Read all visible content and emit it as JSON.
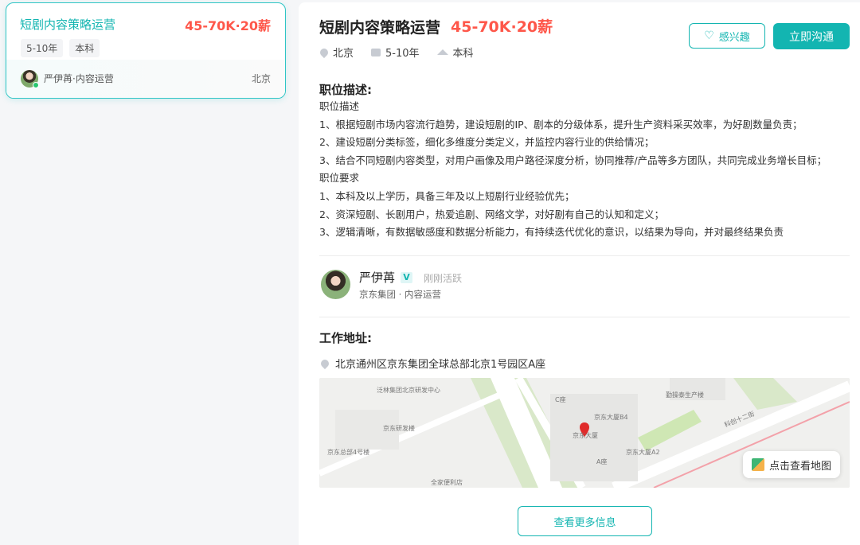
{
  "card": {
    "title": "短剧内容策略运营",
    "salary": "45-70K·20薪",
    "tags": [
      "5-10年",
      "本科"
    ],
    "recruiter": "严伊苒·内容运营",
    "city": "北京"
  },
  "job": {
    "title": "短剧内容策略运营",
    "salary": "45-70K·20薪",
    "city": "北京",
    "experience": "5-10年",
    "education": "本科",
    "interest_label": "感兴趣",
    "chat_label": "立即沟通"
  },
  "description": {
    "heading": "职位描述:",
    "lines": [
      "职位描述",
      "1、根据短剧市场内容流行趋势，建设短剧的IP、剧本的分级体系，提升生产资料采买效率，为好剧数量负责；",
      "2、建设短剧分类标签，细化多维度分类定义，并监控内容行业的供给情况；",
      "3、结合不同短剧内容类型，对用户画像及用户路径深度分析，协同推荐/产品等多方团队，共同完成业务增长目标；",
      "职位要求",
      "1、本科及以上学历，具备三年及以上短剧行业经验优先；",
      "2、资深短剧、长剧用户，热爱追剧、网络文学，对好剧有自己的认知和定义；",
      "3、逻辑清晰，有数据敏感度和数据分析能力，有持续迭代优化的意识，以结果为导向，并对最终结果负责"
    ]
  },
  "recruiter": {
    "name": "严伊苒",
    "badge": "V",
    "status": "刚刚活跃",
    "company": "京东集团 · 内容运营"
  },
  "location": {
    "heading": "工作地址:",
    "address": "北京通州区京东集团全球总部北京1号园区A座",
    "map_button": "点击查看地图",
    "map_labels": [
      "京东研发楼",
      "京东总部4号楼",
      "京东大厦B4",
      "京东大厦A2",
      "京东大厦",
      "勤操泰生产楼",
      "科创十二街",
      "泛林集团北京研发中心",
      "全家便利店",
      "C座",
      "A座"
    ]
  },
  "more_label": "查看更多信息",
  "colors": {
    "accent": "#13b5b1",
    "salary": "#fe574a"
  }
}
